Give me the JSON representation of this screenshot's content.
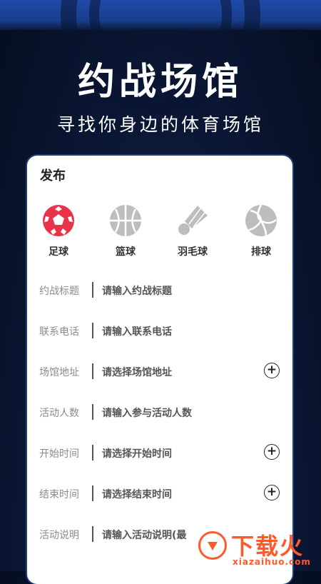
{
  "hero": {
    "title": "约战场馆",
    "subtitle": "寻找你身边的体育场馆"
  },
  "card": {
    "title": "发布",
    "sports": [
      {
        "label": "足球",
        "icon": "football-icon",
        "color": "#e8334a"
      },
      {
        "label": "篮球",
        "icon": "basketball-icon",
        "color": "#bdbdbd"
      },
      {
        "label": "羽毛球",
        "icon": "shuttlecock-icon",
        "color": "#bdbdbd"
      },
      {
        "label": "排球",
        "icon": "volleyball-icon",
        "color": "#bdbdbd"
      }
    ],
    "fields": [
      {
        "label": "约战标题",
        "placeholder": "请输入约战标题",
        "has_add": false
      },
      {
        "label": "联系电话",
        "placeholder": "请输入联系电话",
        "has_add": false
      },
      {
        "label": "场馆地址",
        "placeholder": "请选择场馆地址",
        "has_add": true
      },
      {
        "label": "活动人数",
        "placeholder": "请输入参与活动人数",
        "has_add": false
      },
      {
        "label": "开始时间",
        "placeholder": "请选择开始时间",
        "has_add": true
      },
      {
        "label": "结束时间",
        "placeholder": "请选择结束时间",
        "has_add": true
      },
      {
        "label": "活动说明",
        "placeholder": "请输入活动说明(最",
        "has_add": false
      }
    ],
    "add_symbol": "+"
  },
  "watermark": {
    "title": "下载火",
    "domain": "xiazaihuo.com",
    "color": "#ff5a2a"
  }
}
